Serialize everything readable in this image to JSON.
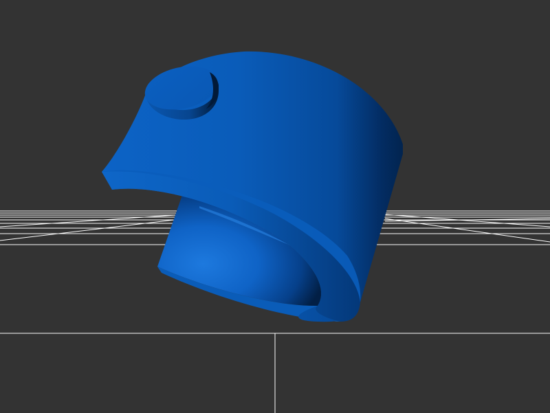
{
  "scene": {
    "background_color": "#333333",
    "grid_color": "#ffffff",
    "model": {
      "shape": "cylinder-with-helical-cut",
      "base_color": "#0a5fc0",
      "highlight_color": "#1e78dc",
      "shadow_color": "#02244f"
    }
  }
}
